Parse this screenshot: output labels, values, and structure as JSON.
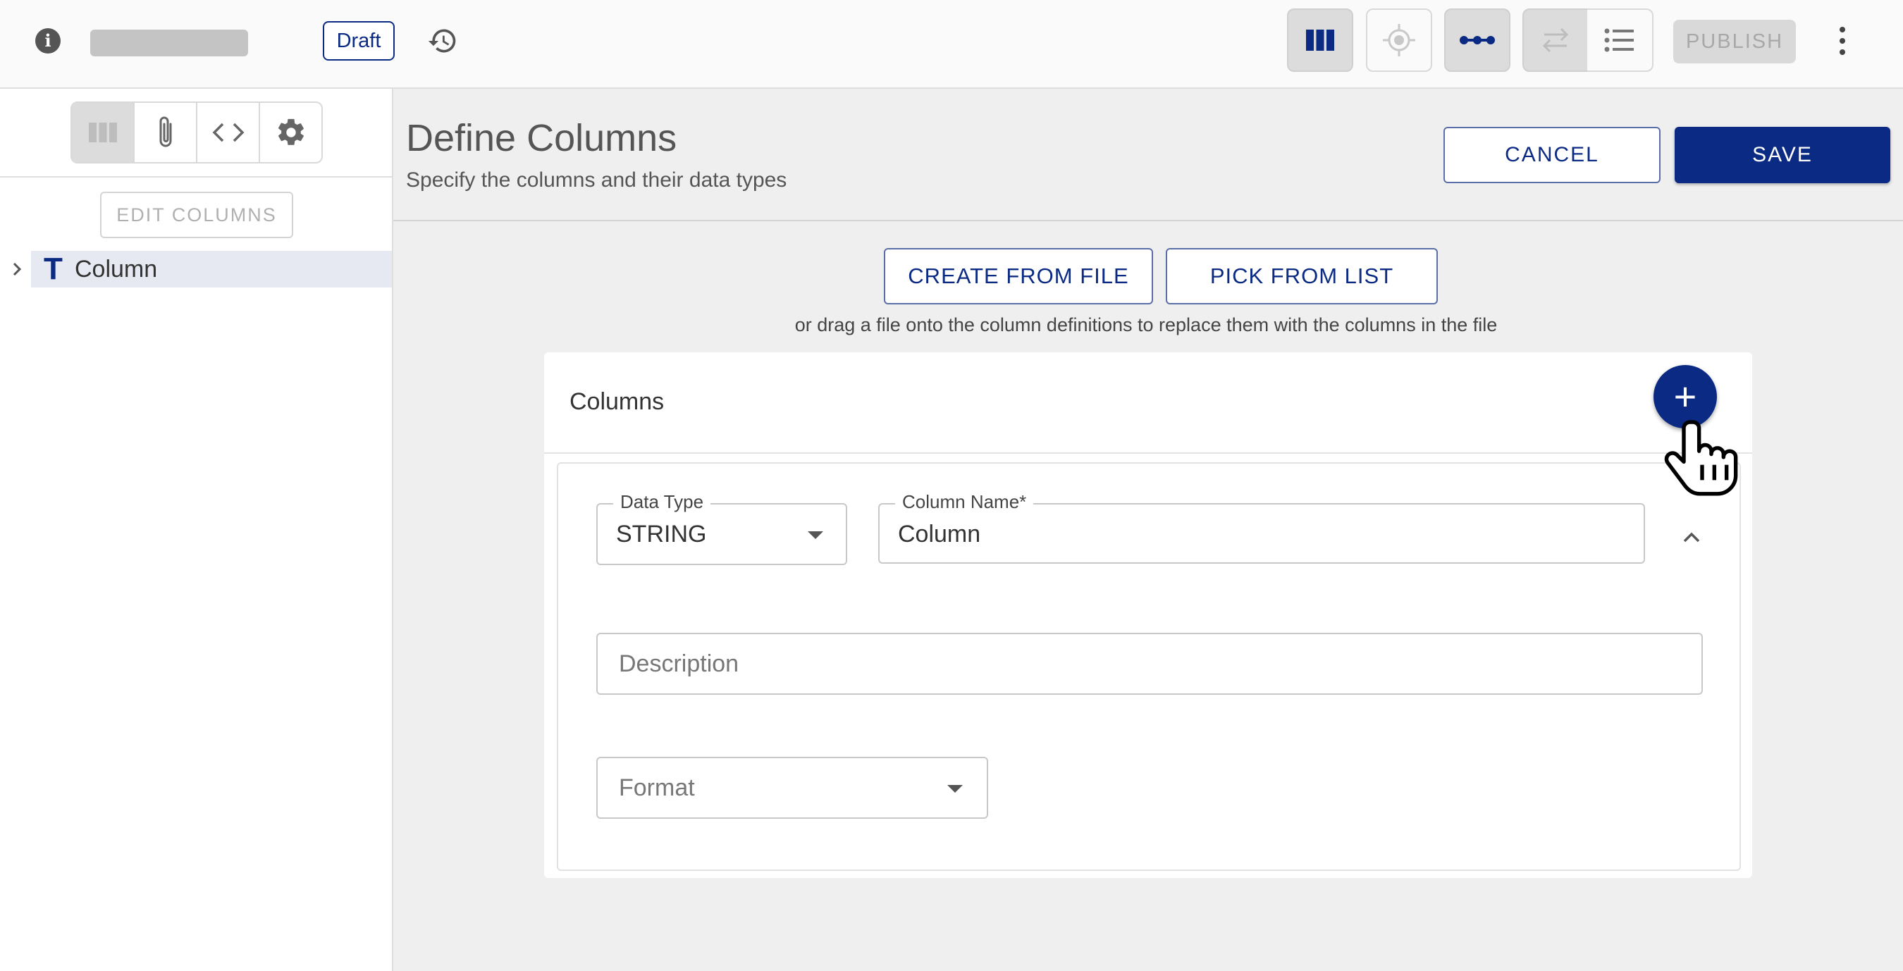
{
  "topbar": {
    "draft_label": "Draft",
    "publish_label": "PUBLISH"
  },
  "sidebar": {
    "edit_columns_label": "EDIT COLUMNS",
    "tree": [
      {
        "label": "Column",
        "type_icon": "T"
      }
    ]
  },
  "main": {
    "title": "Define Columns",
    "subtitle": "Specify the columns and their data types",
    "cancel_label": "CANCEL",
    "save_label": "SAVE",
    "create_from_file_label": "CREATE FROM FILE",
    "pick_from_list_label": "PICK FROM LIST",
    "drag_hint": "or drag a file onto the column definitions to replace them with the columns in the file"
  },
  "columns_card": {
    "title": "Columns",
    "add_symbol": "+",
    "column": {
      "data_type_label": "Data Type",
      "data_type_value": "STRING",
      "column_name_label": "Column Name*",
      "column_name_value": "Column",
      "description_placeholder": "Description",
      "format_placeholder": "Format"
    }
  },
  "colors": {
    "primary": "#0b2a83",
    "disabled": "#d9d9d9",
    "tree_highlight": "#e6e9f1"
  }
}
